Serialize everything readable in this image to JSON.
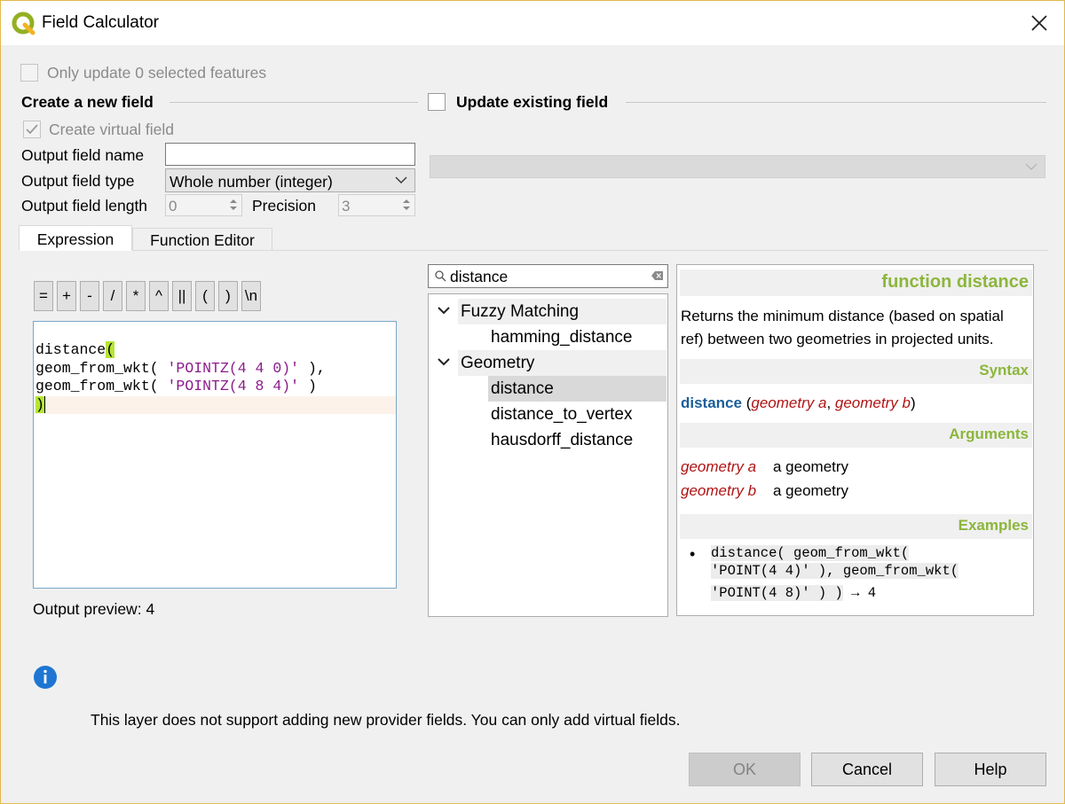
{
  "window": {
    "title": "Field Calculator",
    "accent": "#e3b94a"
  },
  "top": {
    "only_update_label": "Only update 0 selected features"
  },
  "create_group": {
    "title": "Create a new field",
    "virtual_label": "Create virtual field",
    "name_label": "Output field name",
    "name_value": "",
    "type_label": "Output field type",
    "type_value": "Whole number (integer)",
    "length_label": "Output field length",
    "length_value": "0",
    "precision_label": "Precision",
    "precision_value": "3"
  },
  "update_group": {
    "title": "Update existing field",
    "field_value": ""
  },
  "tabs": [
    {
      "label": "Expression"
    },
    {
      "label": "Function Editor"
    }
  ],
  "operators": [
    "=",
    "+",
    "-",
    "/",
    "*",
    "^",
    "||",
    "(",
    ")",
    "\\n"
  ],
  "editor": {
    "line1_fn": "distance",
    "line1_paren": "(",
    "line2_pre": "geom_from_wkt( ",
    "line2_str": "'POINTZ(4 4 0)'",
    "line2_post": " ),",
    "line3_pre": "geom_from_wkt( ",
    "line3_str": "'POINTZ(4 8 4)'",
    "line3_post": " )",
    "line4": ")"
  },
  "preview": {
    "label": "Output preview:",
    "value": "4"
  },
  "search": {
    "value": "distance"
  },
  "tree": [
    {
      "label": "Fuzzy Matching",
      "children": [
        "hamming_distance"
      ]
    },
    {
      "label": "Geometry",
      "children": [
        "distance",
        "distance_to_vertex",
        "hausdorff_distance"
      ]
    }
  ],
  "help": {
    "title": "function distance",
    "description_1": "Returns the minimum distance (based on spatial",
    "description_2": "ref) between two geometries in projected units.",
    "syntax_header": "Syntax",
    "syntax_fn": "distance",
    "syntax_open": "(",
    "syntax_arg1": "geometry a",
    "syntax_comma": ", ",
    "syntax_arg2": "geometry b",
    "syntax_close": ")",
    "arguments_header": "Arguments",
    "arguments": [
      {
        "name": "geometry a",
        "desc": "a geometry"
      },
      {
        "name": "geometry b",
        "desc": "a geometry"
      }
    ],
    "examples_header": "Examples",
    "example_line1": "distance( geom_from_wkt(",
    "example_line2": "'POINT(4 4)' ), geom_from_wkt(",
    "example_line3": "'POINT(4 8)' ) )",
    "example_result": "→ 4"
  },
  "message": {
    "text": "This layer does not support adding new provider fields. You can only add virtual fields."
  },
  "buttons": {
    "ok": "OK",
    "cancel": "Cancel",
    "help": "Help"
  },
  "colors": {
    "help_header": "#8cb63c",
    "syntax_fn": "#1a5e9a",
    "arg": "#b01414",
    "info": "#1e76d2"
  }
}
